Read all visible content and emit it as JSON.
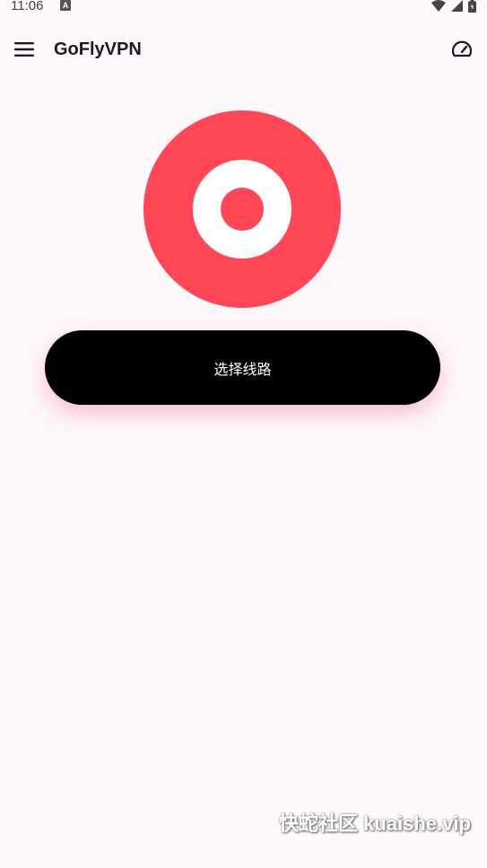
{
  "status_bar": {
    "time": "11:06",
    "notification_icon": "a-badge-icon",
    "icons": [
      "wifi-icon",
      "signal-icon",
      "battery-icon"
    ]
  },
  "app_bar": {
    "menu_icon": "hamburger-menu-icon",
    "title": "GoFlyVPN",
    "speed_icon": "speedometer-icon"
  },
  "main": {
    "connect_indicator_icon": "connection-status-icon",
    "connect_color": "#FF4757",
    "select_route_label": "选择线路"
  },
  "watermark": {
    "text": "快蛇社区 kuaishe.vip"
  }
}
